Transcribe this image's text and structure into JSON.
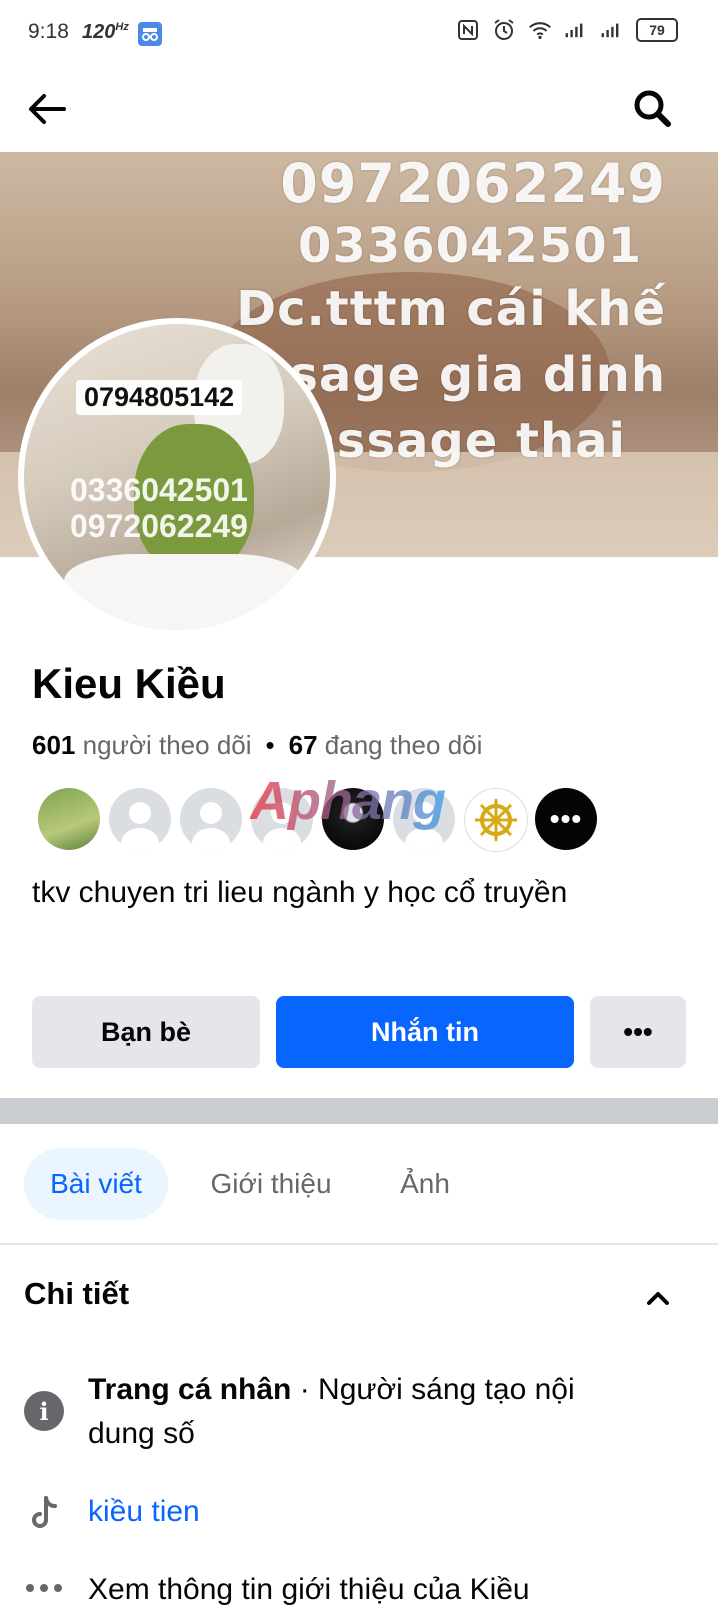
{
  "status_bar": {
    "time": "9:18",
    "refresh_rate": "120",
    "battery": "79"
  },
  "header": {
    "back_icon": "arrow-left-icon",
    "search_icon": "search-icon"
  },
  "cover": {
    "lines": [
      "0972062249",
      "0336042501",
      "Dc.tttm cái khế",
      "ssage gia dinh",
      "Massage thai"
    ]
  },
  "avatar": {
    "phone_label": "0794805142",
    "phone_line1": "0336042501",
    "phone_line2": "0972062249"
  },
  "profile": {
    "name": "Kieu Kiều",
    "followers_count": "601",
    "followers_label": "người theo dõi",
    "following_count": "67",
    "following_label": "đang theo dõi",
    "bio": "tkv chuyen tri lieu ngành y học cổ truyền",
    "watermark": "Aphang"
  },
  "actions": {
    "friends_label": "Bạn bè",
    "message_label": "Nhắn tin",
    "more_label": "•••"
  },
  "tabs": [
    {
      "label": "Bài viết",
      "active": true
    },
    {
      "label": "Giới thiệu",
      "active": false
    },
    {
      "label": "Ảnh",
      "active": false
    }
  ],
  "details": {
    "title": "Chi tiết",
    "items": [
      {
        "icon": "info-icon",
        "bold": "Trang cá nhân",
        "text": " · Người sáng tạo nội dung số"
      },
      {
        "icon": "tiktok-icon",
        "text": "kiều tien"
      },
      {
        "icon": "more-dots-icon",
        "text": "Xem thông tin giới thiệu của Kiều"
      }
    ]
  },
  "colors": {
    "primary": "#0866ff",
    "secondary_text": "#65676b",
    "button_gray": "#e4e6eb",
    "tab_active_bg": "#ebf5ff"
  }
}
